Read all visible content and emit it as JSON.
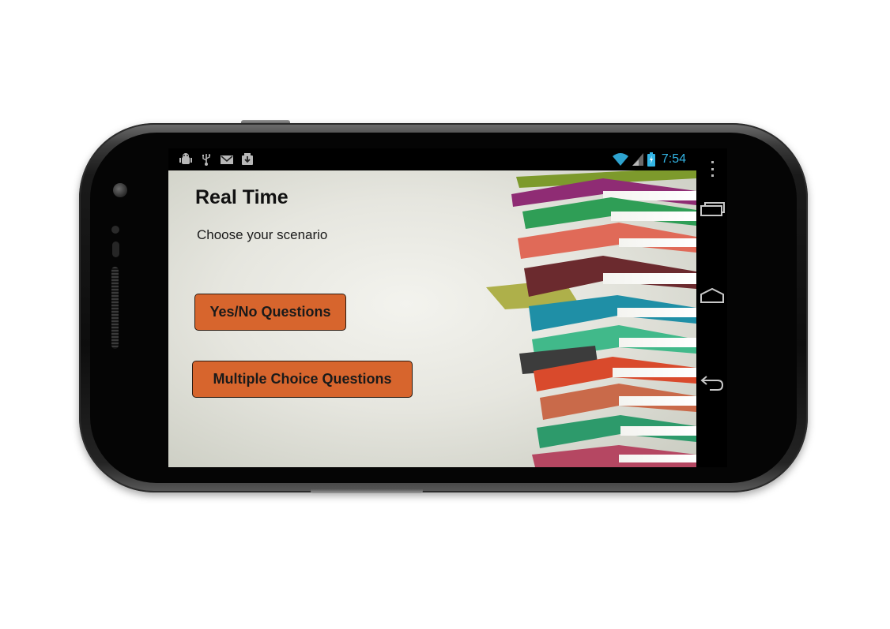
{
  "status_bar": {
    "left_icons": [
      "android-debug-icon",
      "usb-icon",
      "gmail-icon",
      "download-icon"
    ],
    "right_icons": [
      "wifi-icon",
      "signal-icon",
      "battery-charging-icon"
    ],
    "time": "7:54",
    "time_color": "#33b5e5"
  },
  "app": {
    "title": "Real Time",
    "subtitle": "Choose your scenario",
    "buttons": {
      "yes_no": "Yes/No Questions",
      "multiple_choice": "Multiple Choice Questions"
    },
    "button_color": "#d7652d",
    "background_image": "stack-of-books"
  },
  "nav_bar": {
    "icons": [
      "menu-overflow-icon",
      "recent-apps-icon",
      "home-icon",
      "back-icon"
    ]
  }
}
